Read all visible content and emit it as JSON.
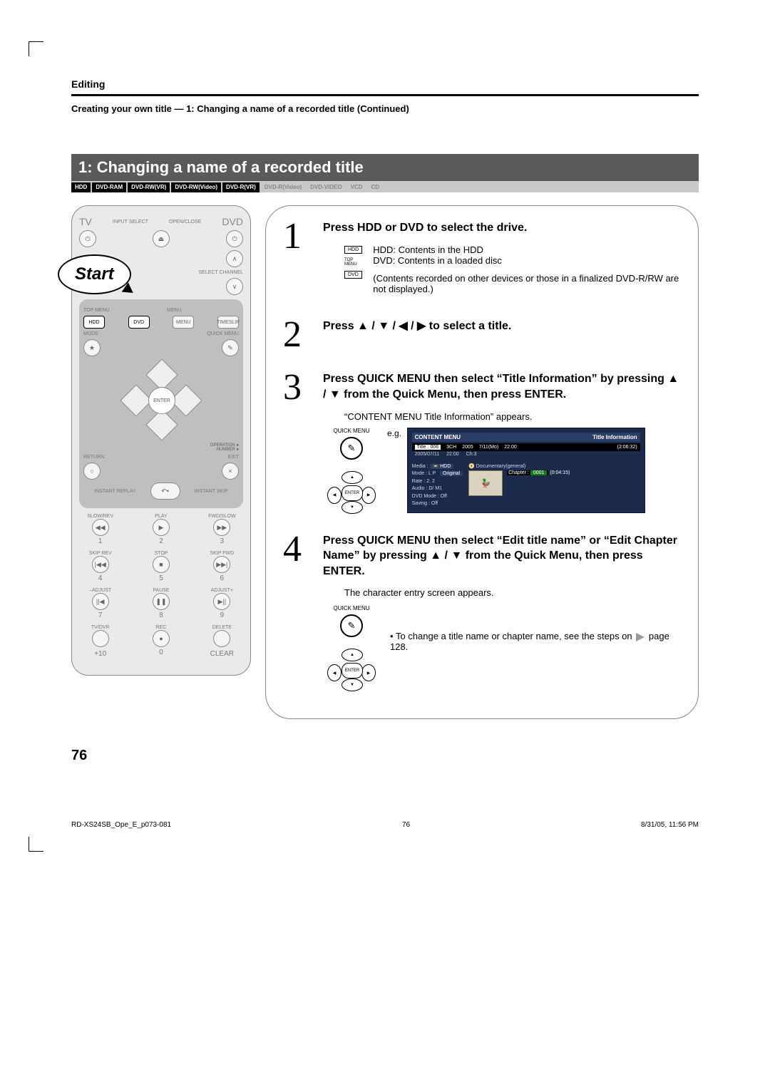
{
  "header": {
    "section": "Editing",
    "breadcrumb": "Creating your own title — 1: Changing a name of a recorded title (Continued)"
  },
  "title": "1: Changing a name of a recorded title",
  "media_chips": {
    "active": [
      "HDD",
      "DVD-RAM"
    ],
    "active_sub": [
      {
        "t": "DVD-RW",
        "s": "(VR)"
      },
      {
        "t": "DVD-RW",
        "s": "(Video)"
      },
      {
        "t": "DVD-R",
        "s": "(VR)"
      }
    ],
    "inactive": [
      {
        "t": "DVD-R",
        "s": "(Video)"
      },
      {
        "t": "DVD-VIDEO",
        "s": ""
      },
      {
        "t": "VCD",
        "s": ""
      },
      {
        "t": "CD",
        "s": ""
      }
    ]
  },
  "remote": {
    "start": "Start",
    "tv": "TV",
    "dvd": "DVD",
    "input_select": "INPUT SELECT",
    "open_close": "OPEN/CLOSE",
    "select_channel": "SELECT CHANNEL",
    "top_menu": "TOP MENU",
    "menu": "MENU",
    "hdd": "HDD",
    "dvd_btn": "DVD",
    "timeslip": "TIMESLIP",
    "mode": "MODE",
    "quick_menu": "QUICK MENU",
    "enter": "ENTER",
    "operation": "OPERATION",
    "number": "NUMBER",
    "return": "RETURN",
    "exit": "EXIT",
    "instant_replay": "INSTANT REPLAY",
    "instant_skip": "INSTANT SKIP",
    "slow_rev": "SLOW/REV",
    "play": "PLAY",
    "fwd_slow": "FWD/SLOW",
    "skip_rev": "SKIP REV",
    "stop": "STOP",
    "skip_fwd": "SKIP FWD",
    "adjust_m": "–ADJUST",
    "pause": "PAUSE",
    "adjust_p": "ADJUST+",
    "tv_dvr": "TV/DVR",
    "rec": "REC",
    "delete": "DELETE",
    "plus10": "+10",
    "zero": "0",
    "clear": "CLEAR",
    "nums": [
      "1",
      "2",
      "3",
      "4",
      "5",
      "6",
      "7",
      "8",
      "9"
    ]
  },
  "steps": {
    "s1": {
      "num": "1",
      "head": "Press HDD or DVD to select the drive.",
      "hdd_box": "HDD",
      "topmenu_lbl": "TOP MENU",
      "dvd_box": "DVD",
      "line1": "HDD: Contents in the HDD",
      "line2": "DVD: Contents in a loaded disc",
      "line3": "(Contents recorded on other devices or those in a finalized DVD-R/RW are not displayed.)"
    },
    "s2": {
      "num": "2",
      "head": "Press ▲ / ▼ / ◀ / ▶ to select a title."
    },
    "s3": {
      "num": "3",
      "head": "Press QUICK MENU then select “Title Information” by pressing ▲ / ▼ from the Quick Menu, then press ENTER.",
      "note": "“CONTENT MENU Title Information” appears.",
      "quick_menu_lbl": "QUICK MENU",
      "enter_lbl": "ENTER",
      "eg": "e.g."
    },
    "s4": {
      "num": "4",
      "head": "Press QUICK MENU then select “Edit title name” or “Edit Chapter Name” by pressing ▲ / ▼ from the Quick Menu, then press ENTER.",
      "note": "The character entry screen appears.",
      "bullet": "To change a title name or chapter name, see the steps on",
      "page_ref": "page 128.",
      "quick_menu_lbl": "QUICK MENU",
      "enter_lbl": "ENTER"
    }
  },
  "osd": {
    "brand": "CONTENT MENU",
    "section": "Title Information",
    "title_lbl": "Title : 006",
    "ch": "3CH",
    "year": "2005",
    "date": "7/11(Mo)",
    "time": "22:00",
    "dur": "(2:06:32)",
    "line2a": "2005/07/11",
    "line2b": "22:00",
    "line2c": "Ch:3",
    "media": "Media :",
    "media_v": "HDD",
    "genre": "Documentary(general)",
    "mode": "Mode : L P",
    "orig": "Original",
    "rate": "Rate : 2. 2",
    "chapter": "Chapter :",
    "chapter_v": "0001",
    "chapter_t": "(0:04:15)",
    "audio": "Audio :        D/ M1",
    "dvdmode": "DVD Mode : Off",
    "saving": "Saving : Off"
  },
  "page_number": "76",
  "footer": {
    "left": "RD-XS24SB_Ope_E_p073-081",
    "center": "76",
    "right": "8/31/05, 11:56 PM"
  }
}
